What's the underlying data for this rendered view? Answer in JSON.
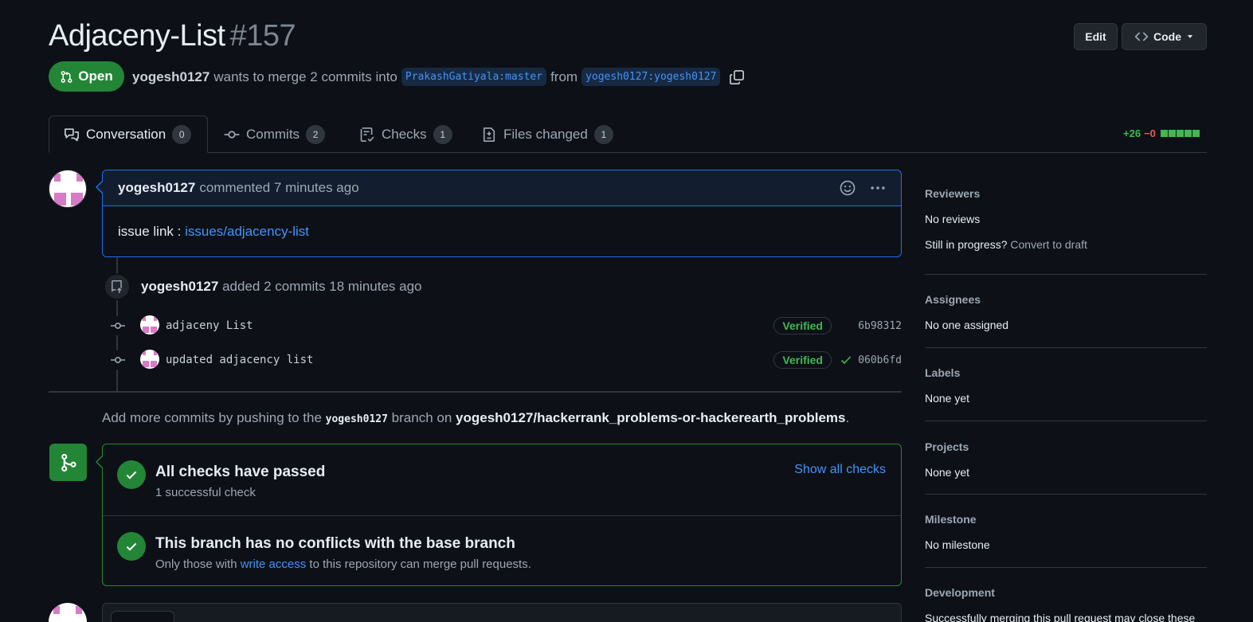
{
  "pr": {
    "title": "Adjaceny-List",
    "number": "#157",
    "state": "Open",
    "author": "yogesh0127",
    "merge_text": "wants to merge 2 commits into",
    "base_branch": "PrakashGatiyala:master",
    "from_text": "from",
    "head_branch": "yogesh0127:yogesh0127"
  },
  "header_buttons": {
    "edit": "Edit",
    "code": "Code"
  },
  "tabs": [
    {
      "label": "Conversation",
      "count": "0",
      "icon": "comment-discussion-icon"
    },
    {
      "label": "Commits",
      "count": "2",
      "icon": "git-commit-icon"
    },
    {
      "label": "Checks",
      "count": "1",
      "icon": "checklist-icon"
    },
    {
      "label": "Files changed",
      "count": "1",
      "icon": "file-diff-icon"
    }
  ],
  "diffstat": {
    "additions": "+26",
    "deletions": "−0"
  },
  "comment": {
    "author": "yogesh0127",
    "action": "commented 7 minutes ago",
    "body_prefix": "issue link :",
    "body_link": "issues/adjacency-list"
  },
  "event": {
    "author": "yogesh0127",
    "text": "added 2 commits 18 minutes ago"
  },
  "commits": [
    {
      "message": "adjaceny List",
      "badge": "Verified",
      "sha": "6b98312",
      "check": false
    },
    {
      "message": "updated adjacency list",
      "badge": "Verified",
      "sha": "060b6fd",
      "check": true
    }
  ],
  "push_note": {
    "prefix": "Add more commits by pushing to the",
    "branch": "yogesh0127",
    "middle": "branch on",
    "repo": "yogesh0127/hackerrank_problems-or-hackerearth_problems",
    "suffix": "."
  },
  "merge_box": {
    "checks_title": "All checks have passed",
    "checks_sub": "1 successful check",
    "show_all": "Show all checks",
    "conflicts_title": "This branch has no conflicts with the base branch",
    "conflicts_sub_prefix": "Only those with",
    "conflicts_sub_link": "write access",
    "conflicts_sub_suffix": "to this repository can merge pull requests."
  },
  "sidebar": {
    "reviewers": {
      "heading": "Reviewers",
      "value": "No reviews",
      "progress": "Still in progress?",
      "draft_link": "Convert to draft"
    },
    "assignees": {
      "heading": "Assignees",
      "value": "No one assigned"
    },
    "labels": {
      "heading": "Labels",
      "value": "None yet"
    },
    "projects": {
      "heading": "Projects",
      "value": "None yet"
    },
    "milestone": {
      "heading": "Milestone",
      "value": "No milestone"
    },
    "development": {
      "heading": "Development",
      "value": "Successfully merging this pull request may close these"
    }
  },
  "colors": {
    "accent": "#4493f8",
    "success": "#238636",
    "open_state": "#238636",
    "danger": "#f85149"
  }
}
